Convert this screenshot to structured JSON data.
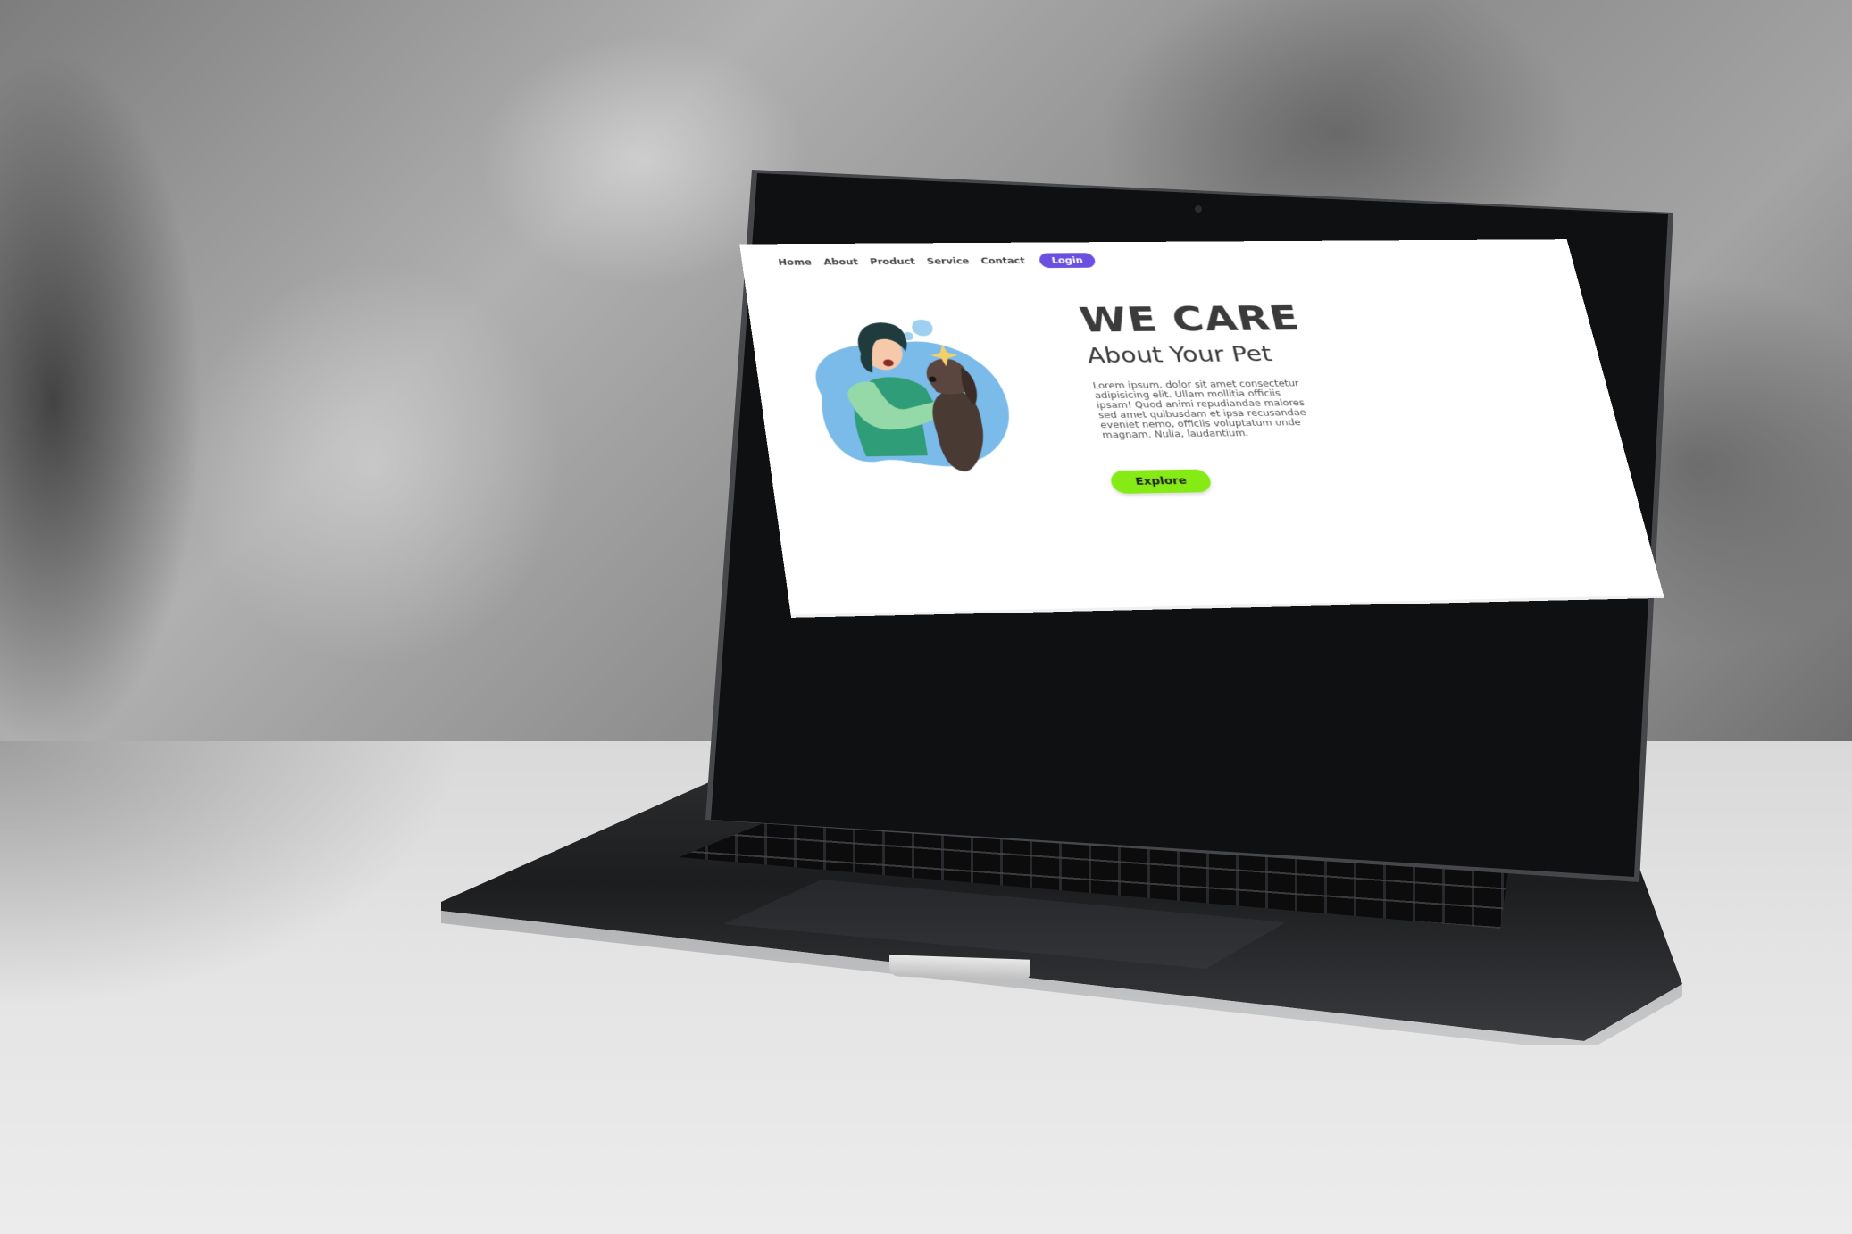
{
  "nav": {
    "items": [
      {
        "label": "Home"
      },
      {
        "label": "About"
      },
      {
        "label": "Product"
      },
      {
        "label": "Service"
      },
      {
        "label": "Contact"
      }
    ],
    "login_label": "Login"
  },
  "hero": {
    "title": "WE CARE",
    "subtitle": "About Your Pet",
    "body": "Lorem ipsum, dolor sit amet consectetur adipisicing elit. Ullam mollitia officiis ipsam! Quod animi repudiandae malores sed amet quibusdam et ipsa recusandae eveniet nemo, officiis voluptatum unde magnam. Nulla, laudantium.",
    "explore_label": "Explore"
  },
  "illustration": {
    "subject": "woman-petting-dog",
    "blob_color": "#6fb3e8",
    "shirt_color": "#2f9d77",
    "hair_color": "#1f3b3d",
    "dog_color": "#4a3a34"
  },
  "colors": {
    "login_button": "#6a4fe0",
    "explore_button": "#86ea14",
    "title": "#3b3b3b"
  }
}
